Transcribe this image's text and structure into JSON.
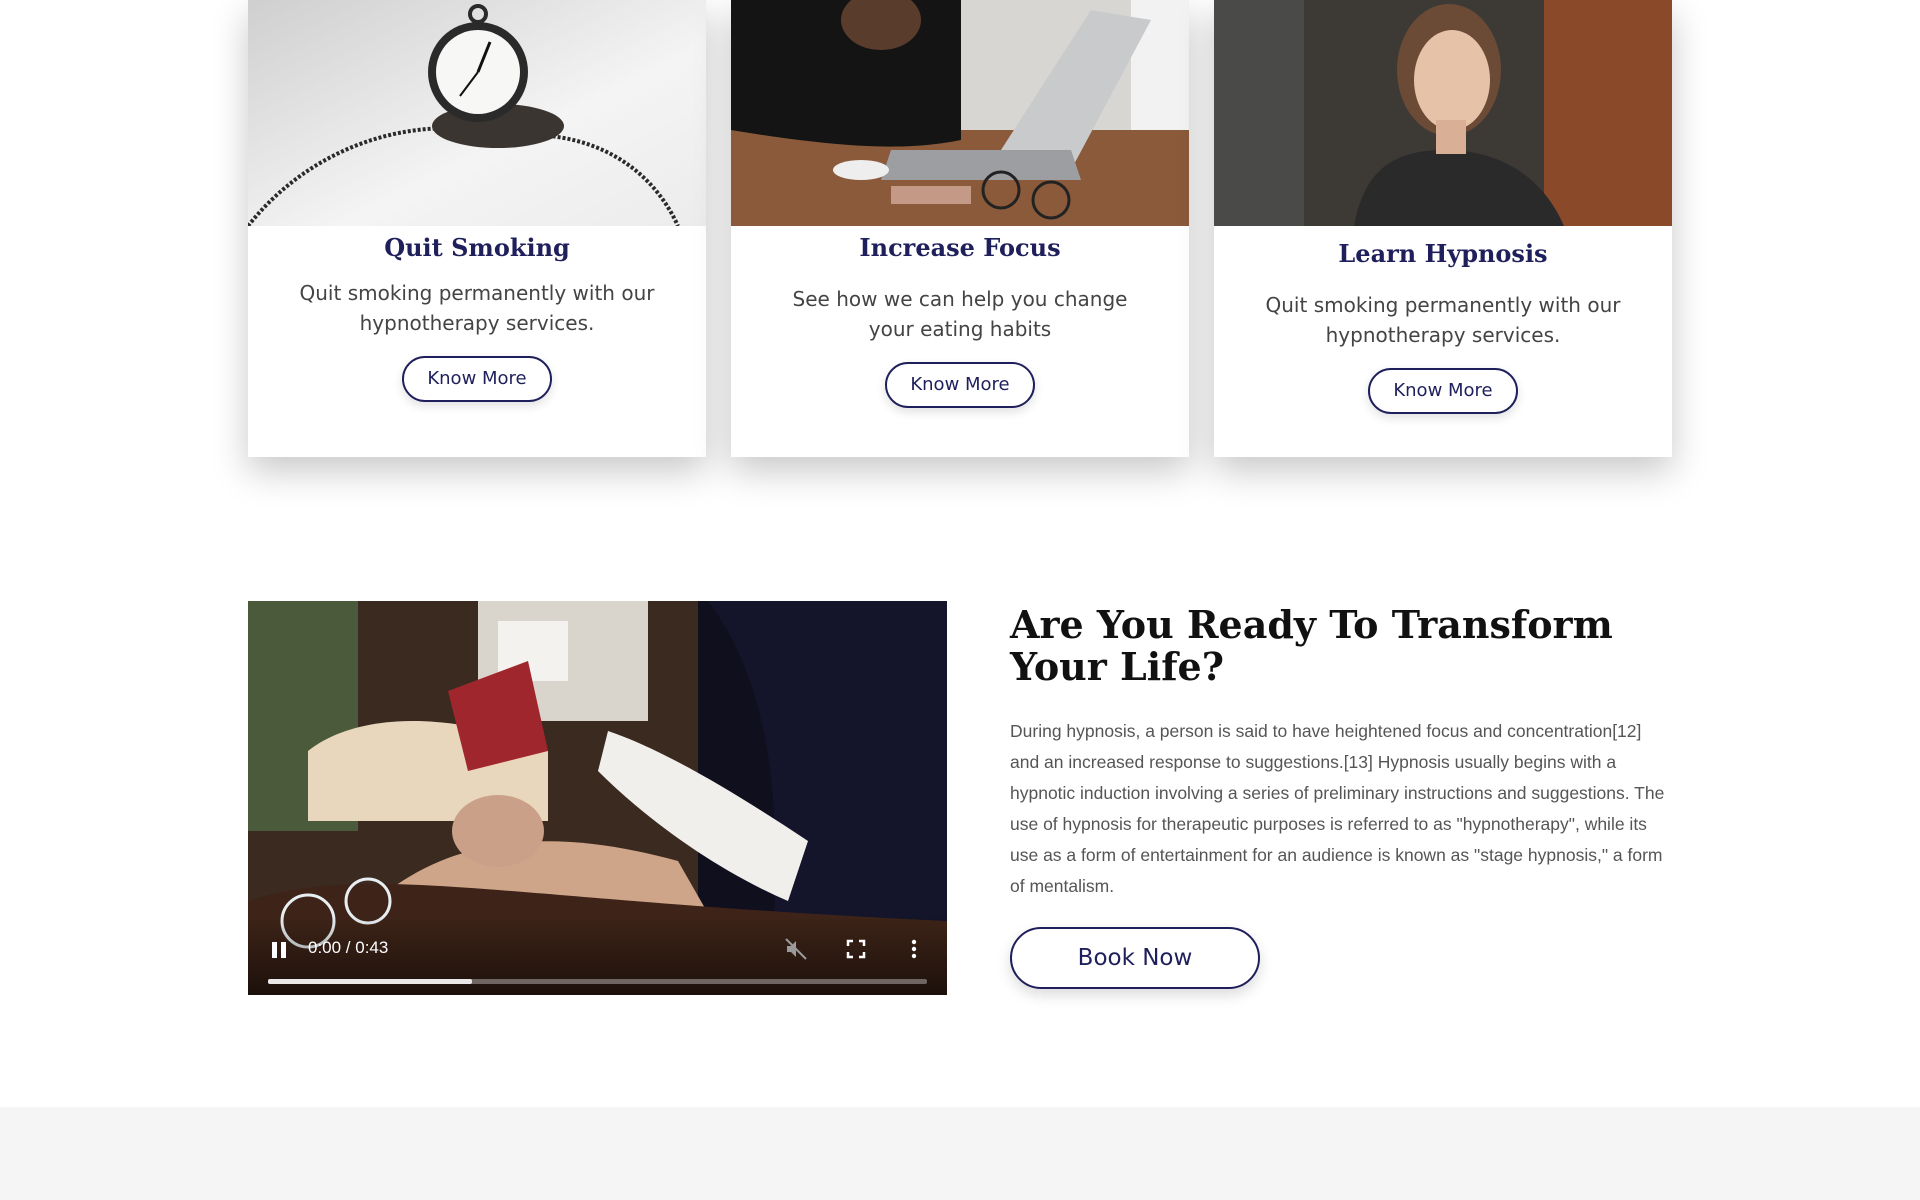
{
  "cards": [
    {
      "title": "Quit Smoking",
      "description": "Quit smoking permanently with our hypnotherapy services.",
      "button": "Know More",
      "image_icon": "pocket-watch-photo"
    },
    {
      "title": "Increase Focus",
      "description": "See how we can help you change your eating habits",
      "button": "Know More",
      "image_icon": "stressed-woman-laptop-photo"
    },
    {
      "title": "Learn Hypnosis",
      "description": "Quit smoking permanently with our hypnotherapy services.",
      "button": "Know More",
      "image_icon": "calm-woman-photo"
    }
  ],
  "video": {
    "time": "0:00 / 0:43",
    "progress": 0.31,
    "state": "playing"
  },
  "cta": {
    "title": "Are You Ready To Transform Your Life?",
    "text": "During hypnosis, a person is said to have heightened focus and concentration[12] and an increased response to suggestions.[13] Hypnosis usually begins with a hypnotic induction involving a series of preliminary instructions and suggestions. The use of hypnosis for therapeutic purposes is referred to as \"hypnotherapy\", while its use as a form of entertainment for an audience is known as \"stage hypnosis,\" a form of mentalism.",
    "button": "Book Now"
  },
  "colors": {
    "accent": "#1f1f5c",
    "footer_band": "#f5f5f5"
  }
}
